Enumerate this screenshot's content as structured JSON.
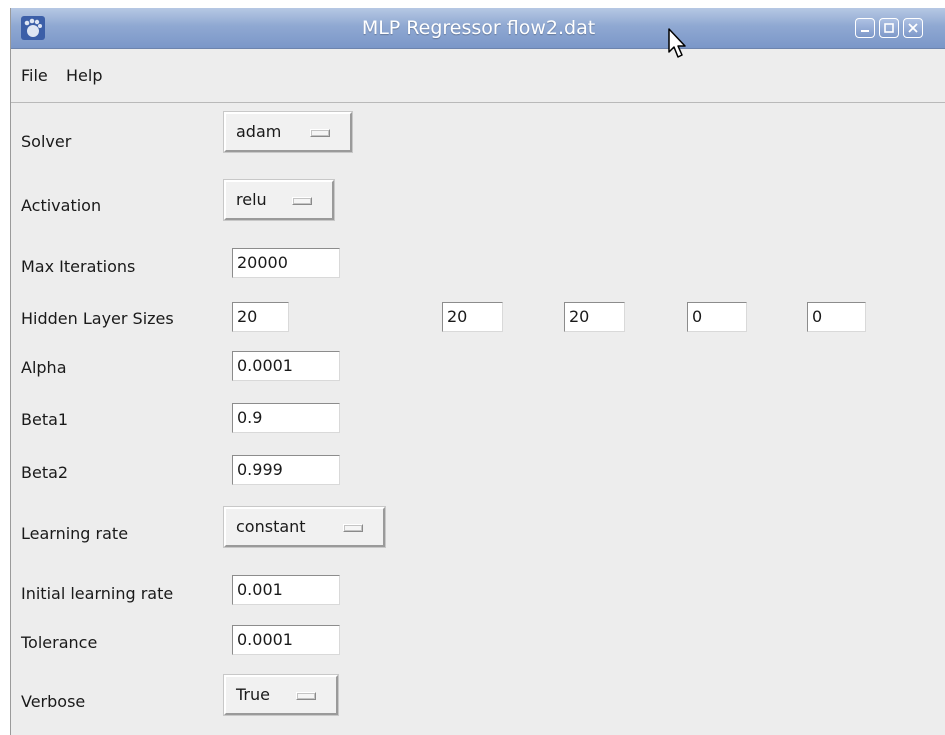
{
  "window": {
    "title": "MLP Regressor flow2.dat",
    "icon": "gnome-foot-icon",
    "controls": [
      "minimize-icon",
      "maximize-icon",
      "close-icon"
    ]
  },
  "menubar": {
    "items": [
      "File",
      "Help"
    ]
  },
  "form": {
    "solver": {
      "label": "Solver",
      "value": "adam"
    },
    "activation": {
      "label": "Activation",
      "value": "relu"
    },
    "max_iterations": {
      "label": "Max Iterations",
      "value": "20000"
    },
    "hidden_layer_sizes": {
      "label": "Hidden Layer Sizes",
      "values": [
        "20",
        "20",
        "20",
        "0",
        "0"
      ]
    },
    "alpha": {
      "label": "Alpha",
      "value": "0.0001"
    },
    "beta1": {
      "label": "Beta1",
      "value": "0.9"
    },
    "beta2": {
      "label": "Beta2",
      "value": "0.999"
    },
    "learning_rate": {
      "label": "Learning rate",
      "value": "constant"
    },
    "initial_learning_rate": {
      "label": "Initial learning rate",
      "value": "0.001"
    },
    "tolerance": {
      "label": "Tolerance",
      "value": "0.0001"
    },
    "verbose": {
      "label": "Verbose",
      "value": "True"
    }
  },
  "colors": {
    "titlebar": "#8fa8d2",
    "window_bg": "#ededed",
    "entry_bg": "#ffffff"
  }
}
